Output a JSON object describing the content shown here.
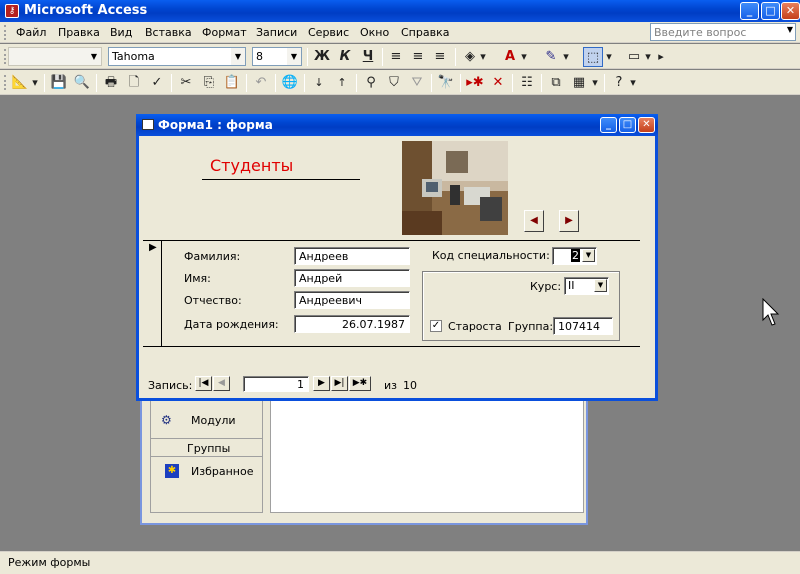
{
  "app": {
    "title": "Microsoft Access",
    "icon": "access-key-icon"
  },
  "menu": [
    "Файл",
    "Правка",
    "Вид",
    "Вставка",
    "Формат",
    "Записи",
    "Сервис",
    "Окно",
    "Справка"
  ],
  "ask_placeholder": "Введите вопрос",
  "format_toolbar": {
    "object": "",
    "font": "Tahoma",
    "size": "8",
    "bold": "Ж",
    "italic": "К",
    "underline": "Ч"
  },
  "statusbar": "Режим формы",
  "form": {
    "window_title": "Форма1 : форма",
    "heading": "Студенты",
    "heading_color": "#e00000",
    "labels": {
      "last_name": "Фамилия:",
      "first_name": "Имя:",
      "patronymic": "Отчество:",
      "birth_date": "Дата рождения:",
      "spec_code": "Код специальности:",
      "course": "Курс:",
      "monitor": "Староста",
      "group": "Группа:"
    },
    "values": {
      "last_name": "Андреев",
      "first_name": "Андрей",
      "patronymic": "Андреевич",
      "birth_date": "26.07.1987",
      "spec_code": "2",
      "course": "II",
      "monitor": true,
      "group": "107414"
    },
    "nav": {
      "label": "Запись:",
      "current": "1",
      "of": "из",
      "total": "10"
    }
  },
  "db_window": {
    "items": [
      {
        "label": "Модули",
        "icon": "module-icon"
      }
    ],
    "groups_header": "Группы",
    "groups": [
      {
        "label": "Избранное",
        "icon": "favorites-icon"
      }
    ]
  }
}
